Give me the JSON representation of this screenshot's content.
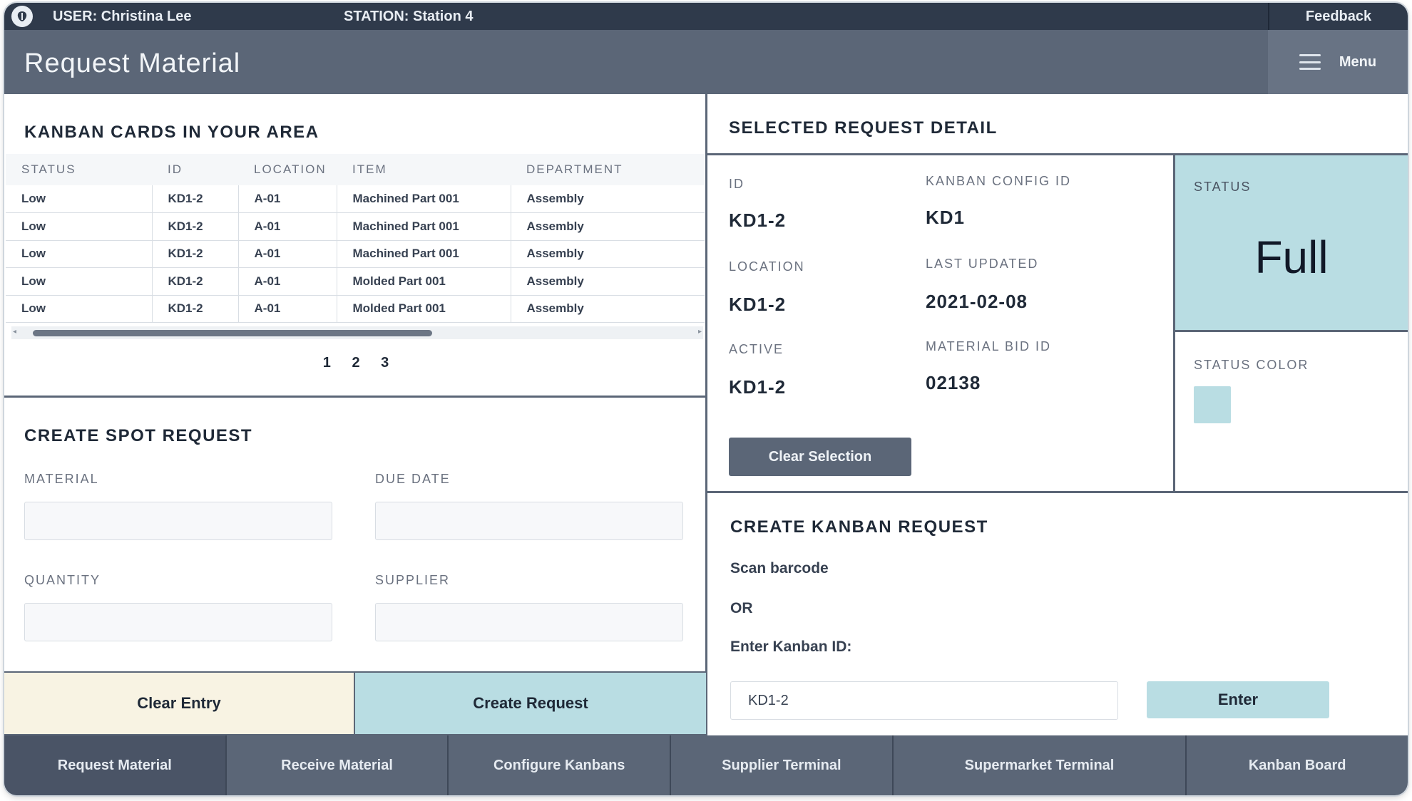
{
  "topbar": {
    "user": "USER: Christina Lee",
    "station": "STATION: Station 4",
    "feedback": "Feedback"
  },
  "header": {
    "title": "Request Material",
    "menu_label": "Menu"
  },
  "kanban_cards": {
    "title": "KANBAN CARDS IN YOUR AREA",
    "columns": [
      "STATUS",
      "ID",
      "LOCATION",
      "ITEM",
      "DEPARTMENT"
    ],
    "rows": [
      [
        "Low",
        "KD1-2",
        "A-01",
        "Machined Part 001",
        "Assembly"
      ],
      [
        "Low",
        "KD1-2",
        "A-01",
        "Machined Part 001",
        "Assembly"
      ],
      [
        "Low",
        "KD1-2",
        "A-01",
        "Machined Part 001",
        "Assembly"
      ],
      [
        "Low",
        "KD1-2",
        "A-01",
        "Molded Part 001",
        "Assembly"
      ],
      [
        "Low",
        "KD1-2",
        "A-01",
        "Molded Part 001",
        "Assembly"
      ]
    ],
    "pages": [
      "1",
      "2",
      "3"
    ]
  },
  "spot_request": {
    "title": "CREATE SPOT REQUEST",
    "material_label": "MATERIAL",
    "due_date_label": "DUE DATE",
    "quantity_label": "QUANTITY",
    "supplier_label": "SUPPLIER",
    "material_value": "",
    "due_date_value": "",
    "quantity_value": "",
    "supplier_value": "",
    "clear_label": "Clear Entry",
    "create_label": "Create Request"
  },
  "detail": {
    "title": "SELECTED REQUEST DETAIL",
    "id_label": "ID",
    "id_value": "KD1-2",
    "kanban_config_label": "KANBAN CONFIG ID",
    "kanban_config_value": "KD1",
    "location_label": "LOCATION",
    "location_value": "KD1-2",
    "last_updated_label": "LAST UPDATED",
    "last_updated_value": "2021-02-08",
    "active_label": "ACTIVE",
    "active_value": "KD1-2",
    "material_bid_label": "MATERIAL BID ID",
    "material_bid_value": "02138",
    "clear_selection_label": "Clear Selection",
    "status_label": "STATUS",
    "status_value": "Full",
    "status_color_label": "STATUS COLOR",
    "status_color": "#b9dde3"
  },
  "kanban_request": {
    "title": "CREATE KANBAN REQUEST",
    "scan_text": "Scan barcode",
    "or_text": "OR",
    "enter_id_text": "Enter Kanban ID:",
    "input_value": "KD1-2",
    "enter_label": "Enter"
  },
  "bottom_nav": [
    {
      "label": "Request Material",
      "active": true
    },
    {
      "label": "Receive Material",
      "active": false
    },
    {
      "label": "Configure Kanbans",
      "active": false
    },
    {
      "label": "Supplier Terminal",
      "active": false
    },
    {
      "label": "Supermarket Terminal",
      "active": false
    },
    {
      "label": "Kanban Board",
      "active": false
    }
  ],
  "colors": {
    "accent_teal": "#b9dde3",
    "header_slate": "#5b6677",
    "topbar_dark": "#2f3a4b",
    "cream": "#f8f3e3"
  }
}
